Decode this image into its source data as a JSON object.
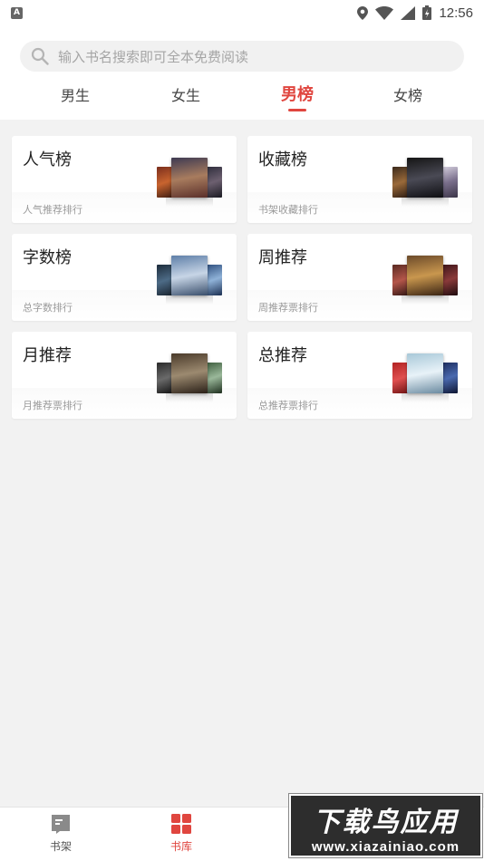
{
  "status_bar": {
    "time": "12:56",
    "notification_letter": "A"
  },
  "search": {
    "placeholder": "输入书名搜索即可全本免费阅读"
  },
  "tabs": [
    {
      "label": "男生",
      "active": false
    },
    {
      "label": "女生",
      "active": false
    },
    {
      "label": "男榜",
      "active": true
    },
    {
      "label": "女榜",
      "active": false
    }
  ],
  "cards": [
    {
      "title": "人气榜",
      "subtitle": "人气推荐排行"
    },
    {
      "title": "收藏榜",
      "subtitle": "书架收藏排行"
    },
    {
      "title": "字数榜",
      "subtitle": "总字数排行"
    },
    {
      "title": "周推荐",
      "subtitle": "周推荐票排行"
    },
    {
      "title": "月推荐",
      "subtitle": "月推荐票排行"
    },
    {
      "title": "总推荐",
      "subtitle": "总推荐票排行"
    }
  ],
  "bottom_nav": [
    {
      "label": "书架",
      "icon": "bookshelf-icon",
      "active": false
    },
    {
      "label": "书库",
      "icon": "library-grid-icon",
      "active": true
    }
  ],
  "watermark": {
    "line1": "下载鸟应用",
    "line2": "www.xiazainiao.com"
  },
  "colors": {
    "accent": "#e0463f",
    "background": "#f2f2f2"
  }
}
